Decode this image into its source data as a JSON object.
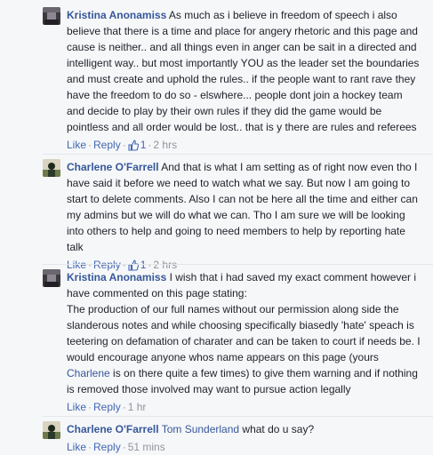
{
  "comments": [
    {
      "author": "Kristina Anonamiss",
      "text": "As much as i believe in freedom of speech i also believe that there is a time and place for angery rhetoric and this page and cause is neither.. and all things even in anger can be sait in a directed and intelligent way.. but most importantly YOU as the leader set the boundaries and must create and uphold the rules.. if the people want to rant rave they have the freedom to do so - elswhere... people dont join a hockey team and decide to play by their own rules if they did the game would be pointless and all order would be lost.. that is y there are rules and referees",
      "like_label": "Like",
      "reply_label": "Reply",
      "like_count": "1",
      "time": "2 hrs",
      "avatar_icon": "avatar-photo-icon"
    },
    {
      "author": "Charlene O'Farrell",
      "text": "And that is what I am setting as of right now even tho I have said it before we need to watch what we say. But now I am going to start to delete comments. Also I can not be here all the time and either can my admins but we will do what we can. Tho I am sure we will be looking into others to help and going to need members to help by reporting hate talk",
      "like_label": "Like",
      "reply_label": "Reply",
      "like_count": "1",
      "time": "2 hrs",
      "avatar_icon": "avatar-photo-icon"
    },
    {
      "author": "Kristina Anonamiss",
      "text_a": "I wish that i had saved my exact comment however i have commented on this page stating:\nThe production of our full names without our permission along side the slanderous notes and while choosing specifically biasedly 'hate' speach is teetering on defamation of charater and can be taken to court if needs be. I would encourage anyone whos name appears on this page (yours ",
      "mention": "Charlene",
      "text_b": " is on there quite a few times) to give them warning and if nothing is removed those involved may want to pursue action legally",
      "like_label": "Like",
      "reply_label": "Reply",
      "time": "1 hr",
      "avatar_icon": "avatar-photo-icon"
    },
    {
      "author": "Charlene O'Farrell",
      "mention": "Tom Sunderland",
      "text": "what do u say?",
      "like_label": "Like",
      "reply_label": "Reply",
      "time": "51 mins",
      "avatar_icon": "avatar-photo-icon"
    }
  ],
  "colors": {
    "background": "#f6f7f9",
    "link": "#365899",
    "action": "#4267b2",
    "meta": "#90949c",
    "text": "#1d2129"
  }
}
